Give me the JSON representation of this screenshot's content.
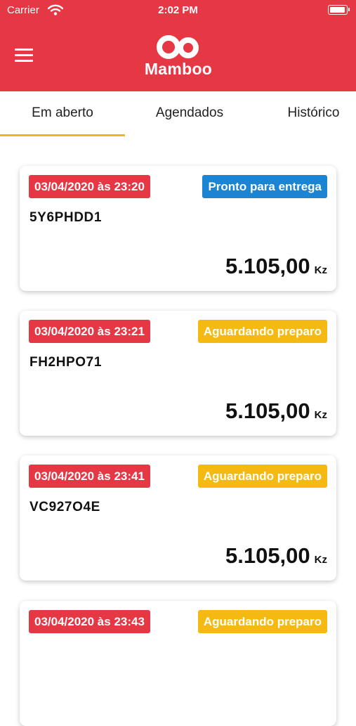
{
  "status_bar": {
    "carrier": "Carrier",
    "time": "2:02 PM"
  },
  "header": {
    "logo_text": "Mamboo"
  },
  "tabs": [
    {
      "label": "Em aberto",
      "active": true
    },
    {
      "label": "Agendados",
      "active": false
    },
    {
      "label": "Histórico",
      "active": false
    }
  ],
  "orders": [
    {
      "date": "03/04/2020 às 23:20",
      "status": "Pronto para entrega",
      "status_color": "#1b84d3",
      "code": "5Y6PHDD1",
      "amount": "5.105,00",
      "currency": "Kz"
    },
    {
      "date": "03/04/2020 às 23:21",
      "status": "Aguardando preparo",
      "status_color": "#f5ba12",
      "code": "FH2HPO71",
      "amount": "5.105,00",
      "currency": "Kz"
    },
    {
      "date": "03/04/2020 às 23:41",
      "status": "Aguardando preparo",
      "status_color": "#f5ba12",
      "code": "VC927O4E",
      "amount": "5.105,00",
      "currency": "Kz"
    },
    {
      "date": "03/04/2020 às 23:43",
      "status": "Aguardando preparo",
      "status_color": "#f5ba12",
      "code": "",
      "amount": "",
      "currency": ""
    }
  ],
  "colors": {
    "brand_red": "#e63744",
    "tab_indicator": "#f2b322",
    "ready_blue": "#1b84d3",
    "waiting_yellow": "#f5ba12"
  },
  "icons": {
    "menu": "hamburger-menu-icon",
    "wifi": "wifi-icon",
    "battery": "battery-icon"
  }
}
